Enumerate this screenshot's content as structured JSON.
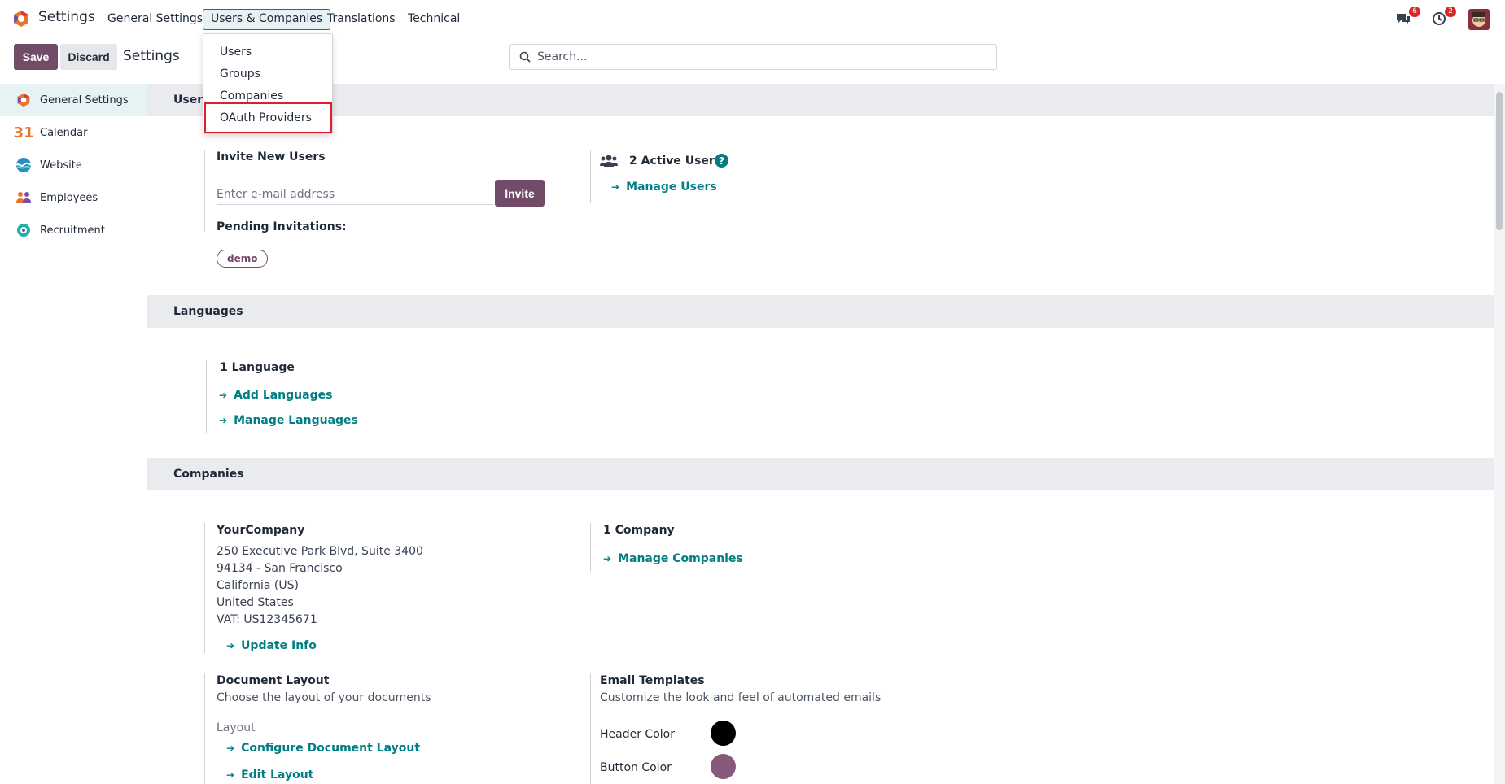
{
  "navbar": {
    "app_title": "Settings",
    "menus": [
      "General Settings",
      "Users & Companies",
      "Translations",
      "Technical"
    ],
    "messages_badge": "6",
    "activity_badge": "2"
  },
  "dropdown": {
    "items": [
      "Users",
      "Groups",
      "Companies",
      "OAuth Providers"
    ]
  },
  "control": {
    "save_label": "Save",
    "discard_label": "Discard",
    "breadcrumb": "Settings",
    "search_placeholder": "Search..."
  },
  "sidebar": {
    "items": [
      {
        "label": "General Settings",
        "icon": "odoo-icon"
      },
      {
        "label": "Calendar",
        "icon": "calendar-31-icon"
      },
      {
        "label": "Website",
        "icon": "website-icon"
      },
      {
        "label": "Employees",
        "icon": "employees-icon"
      },
      {
        "label": "Recruitment",
        "icon": "recruitment-icon"
      }
    ]
  },
  "users_section": {
    "title": "Users",
    "invite_title": "Invite New Users",
    "email_placeholder": "Enter e-mail address",
    "invite_label": "Invite",
    "pending_label": "Pending Invitations:",
    "pending_tags": [
      "demo"
    ],
    "active_users": "2 Active Users",
    "manage_users": "Manage Users"
  },
  "languages_section": {
    "title": "Languages",
    "count": "1 Language",
    "add_link": "Add Languages",
    "manage_link": "Manage Languages"
  },
  "companies_section": {
    "title": "Companies",
    "company_name": "YourCompany",
    "address_lines": [
      "250 Executive Park Blvd, Suite 3400",
      "94134 - San Francisco",
      "California (US)",
      "United States",
      "VAT:  US12345671"
    ],
    "update_link": "Update Info",
    "company_count": "1 Company",
    "manage_companies": "Manage Companies",
    "doc_layout_title": "Document Layout",
    "doc_layout_desc": "Choose the layout of your documents",
    "layout_label": "Layout",
    "configure_link": "Configure Document Layout",
    "edit_link": "Edit Layout",
    "email_templates_title": "Email Templates",
    "email_templates_desc": "Customize the look and feel of automated emails",
    "header_color_label": "Header Color",
    "button_color_label": "Button Color"
  },
  "colors": {
    "brand": "#714b67",
    "link": "#017e84",
    "header_color": "#000000",
    "button_color": "#875a7b"
  }
}
